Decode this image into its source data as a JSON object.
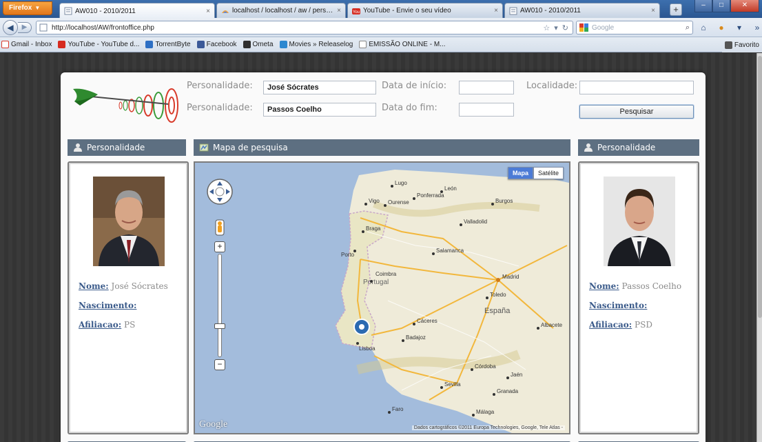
{
  "browser": {
    "app_button": "Firefox",
    "tabs": [
      {
        "label": "AW010 - 2010/2011",
        "active": true
      },
      {
        "label": "localhost / localhost / aw / personali...",
        "active": false
      },
      {
        "label": "YouTube - Envie o seu vídeo",
        "active": false
      },
      {
        "label": "AW010 - 2010/2011",
        "active": false
      }
    ],
    "url": "http://localhost/AW/frontoffice.php",
    "search_placeholder": "Google",
    "bookmarks": [
      {
        "label": "Gmail - Inbox",
        "icon": "gmail-icon",
        "color": "#d93a2b"
      },
      {
        "label": "YouTube - YouTube d...",
        "icon": "youtube-icon",
        "color": "#d62b1f"
      },
      {
        "label": "TorrentByte",
        "icon": "torrentbyte-icon",
        "color": "#2d6fc4"
      },
      {
        "label": "Facebook",
        "icon": "facebook-icon",
        "color": "#3b5998"
      },
      {
        "label": "Ometa",
        "icon": "ometa-icon",
        "color": "#2f2f2f"
      },
      {
        "label": "Movies » Releaselog",
        "icon": "movies-icon",
        "color": "#2c88d0"
      },
      {
        "label": "EMISSÃO ONLINE - M...",
        "icon": "page-icon",
        "color": "#ffffff"
      }
    ],
    "favorites_label": "Favorito"
  },
  "search_form": {
    "personalidade_label": "Personalidade:",
    "personalidade_1": "José Sócrates",
    "personalidade_2": "Passos Coelho",
    "data_inicio_label": "Data de início:",
    "data_fim_label": "Data do fim:",
    "data_inicio_value": "",
    "data_fim_value": "",
    "localidade_label": "Localidade:",
    "localidade_value": "",
    "search_button": "Pesquisar"
  },
  "left_panel": {
    "header": "Personalidade",
    "nome_key": "Nome:",
    "nome_value": " José Sócrates",
    "nascimento_key": "Nascimento:",
    "nascimento_value": "",
    "afiliacao_key": "Afiliacao:",
    "afiliacao_value": " PS"
  },
  "map_panel": {
    "header": "Mapa de pesquisa",
    "type_map": "Mapa",
    "type_satellite": "Satélite",
    "logo": "Google",
    "credit": "Dados cartográficos ©2011 Europa Technologies, Google, Tele Atlas -",
    "cities": [
      "Vigo",
      "Ourense",
      "Lugo",
      "Ponferrada",
      "León",
      "Burgos",
      "Braga",
      "Porto",
      "Valladolid",
      "Salamanca",
      "Portugal",
      "Madrid",
      "Toledo",
      "Coimbra",
      "España",
      "Cáceres",
      "Lisboa",
      "Badajoz",
      "Albacete",
      "Córdoba",
      "Sevilla",
      "Granada",
      "Málaga",
      "Faro",
      "Jaén"
    ]
  },
  "right_panel": {
    "header": "Personalidade",
    "nome_key": "Nome:",
    "nome_value": " Passos Coelho",
    "nascimento_key": "Nascimento:",
    "nascimento_value": "",
    "afiliacao_key": "Afiliacao:",
    "afiliacao_value": " PSD"
  },
  "colors": {
    "section_header": "#5d6f81",
    "link": "#3a5a8a",
    "map_active_button": "#4c7bd6"
  }
}
